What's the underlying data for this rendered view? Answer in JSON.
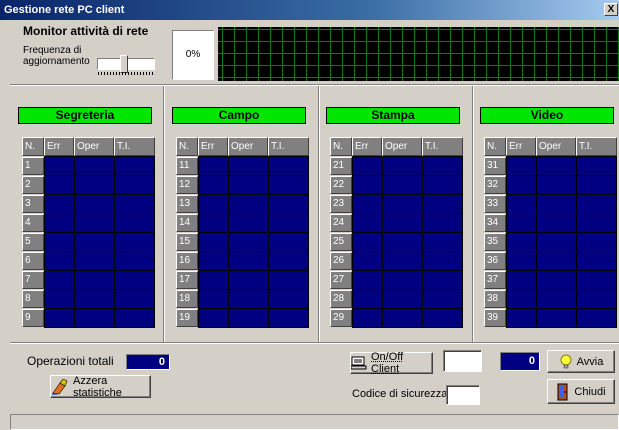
{
  "window": {
    "title": "Gestione rete PC client",
    "close_label": "X"
  },
  "monitor": {
    "title": "Monitor attività di rete",
    "freq_label_line1": "Frequenza di",
    "freq_label_line2": "aggiornamento",
    "percent": "0%"
  },
  "columns": {
    "n": "N.",
    "err": "Err",
    "oper": "Oper",
    "ti": "T.I."
  },
  "groups": [
    {
      "name": "Segreteria",
      "rows": [
        "1",
        "2",
        "3",
        "4",
        "5",
        "6",
        "7",
        "8",
        "9"
      ]
    },
    {
      "name": "Campo",
      "rows": [
        "11",
        "12",
        "13",
        "14",
        "15",
        "16",
        "17",
        "18",
        "19"
      ]
    },
    {
      "name": "Stampa",
      "rows": [
        "21",
        "22",
        "23",
        "24",
        "25",
        "26",
        "27",
        "28",
        "29"
      ]
    },
    {
      "name": "Video",
      "rows": [
        "31",
        "32",
        "33",
        "34",
        "35",
        "36",
        "37",
        "38",
        "39"
      ]
    }
  ],
  "footer": {
    "ops_label": "Operazioni totali",
    "ops_value": "0",
    "reset_button": "Azzera statistiche",
    "onoff_button": "On/Off Client",
    "counter_value": "0",
    "code_label": "Codice di sicurezza",
    "start_button": "Avvia",
    "close_button": "Chiudi"
  },
  "colors": {
    "group_green": "#00e600",
    "grid_navy": "#000080",
    "graph_green": "#0c7a0c"
  }
}
